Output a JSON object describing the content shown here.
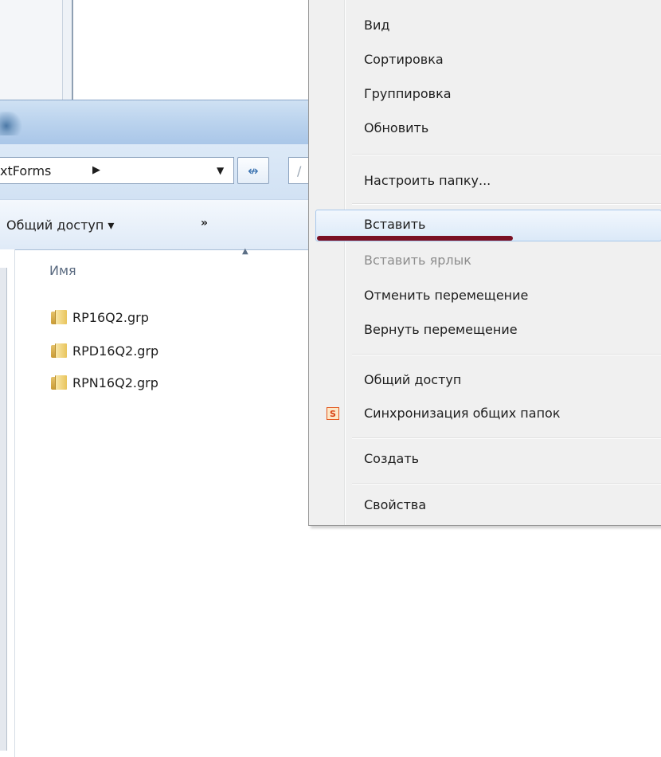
{
  "explorer": {
    "address": {
      "path_fragment": "xtForms",
      "separator_icon": "chevron-right",
      "dropdown_icon": "caret-down"
    },
    "refresh_icon": "refresh-arrows",
    "toolbar": {
      "share_label": "Общий доступ ▾",
      "more_label": "»"
    },
    "columns": {
      "name_header": "Имя",
      "sort_icon": "sort-ascending"
    },
    "files": [
      {
        "name": "RP16Q2.grp",
        "icon": "folder-icon"
      },
      {
        "name": "RPD16Q2.grp",
        "icon": "folder-icon"
      },
      {
        "name": "RPN16Q2.grp",
        "icon": "folder-icon"
      }
    ]
  },
  "context_menu": {
    "items": [
      {
        "label": "Вид",
        "state": "normal"
      },
      {
        "label": "Сортировка",
        "state": "normal"
      },
      {
        "label": "Группировка",
        "state": "normal"
      },
      {
        "label": "Обновить",
        "state": "normal"
      },
      {
        "label": "Настроить папку...",
        "state": "normal"
      },
      {
        "label": "Вставить",
        "state": "hover"
      },
      {
        "label": "Вставить ярлык",
        "state": "disabled"
      },
      {
        "label": "Отменить перемещение",
        "state": "normal"
      },
      {
        "label": "Вернуть перемещение",
        "state": "normal"
      },
      {
        "label": "Общий доступ",
        "state": "normal"
      },
      {
        "label": "Синхронизация общих папок",
        "state": "normal",
        "icon_text": "S"
      },
      {
        "label": "Создать",
        "state": "normal"
      },
      {
        "label": "Свойства",
        "state": "normal"
      }
    ]
  },
  "annotation": {
    "color": "#7a1023",
    "target": "Вставить"
  }
}
